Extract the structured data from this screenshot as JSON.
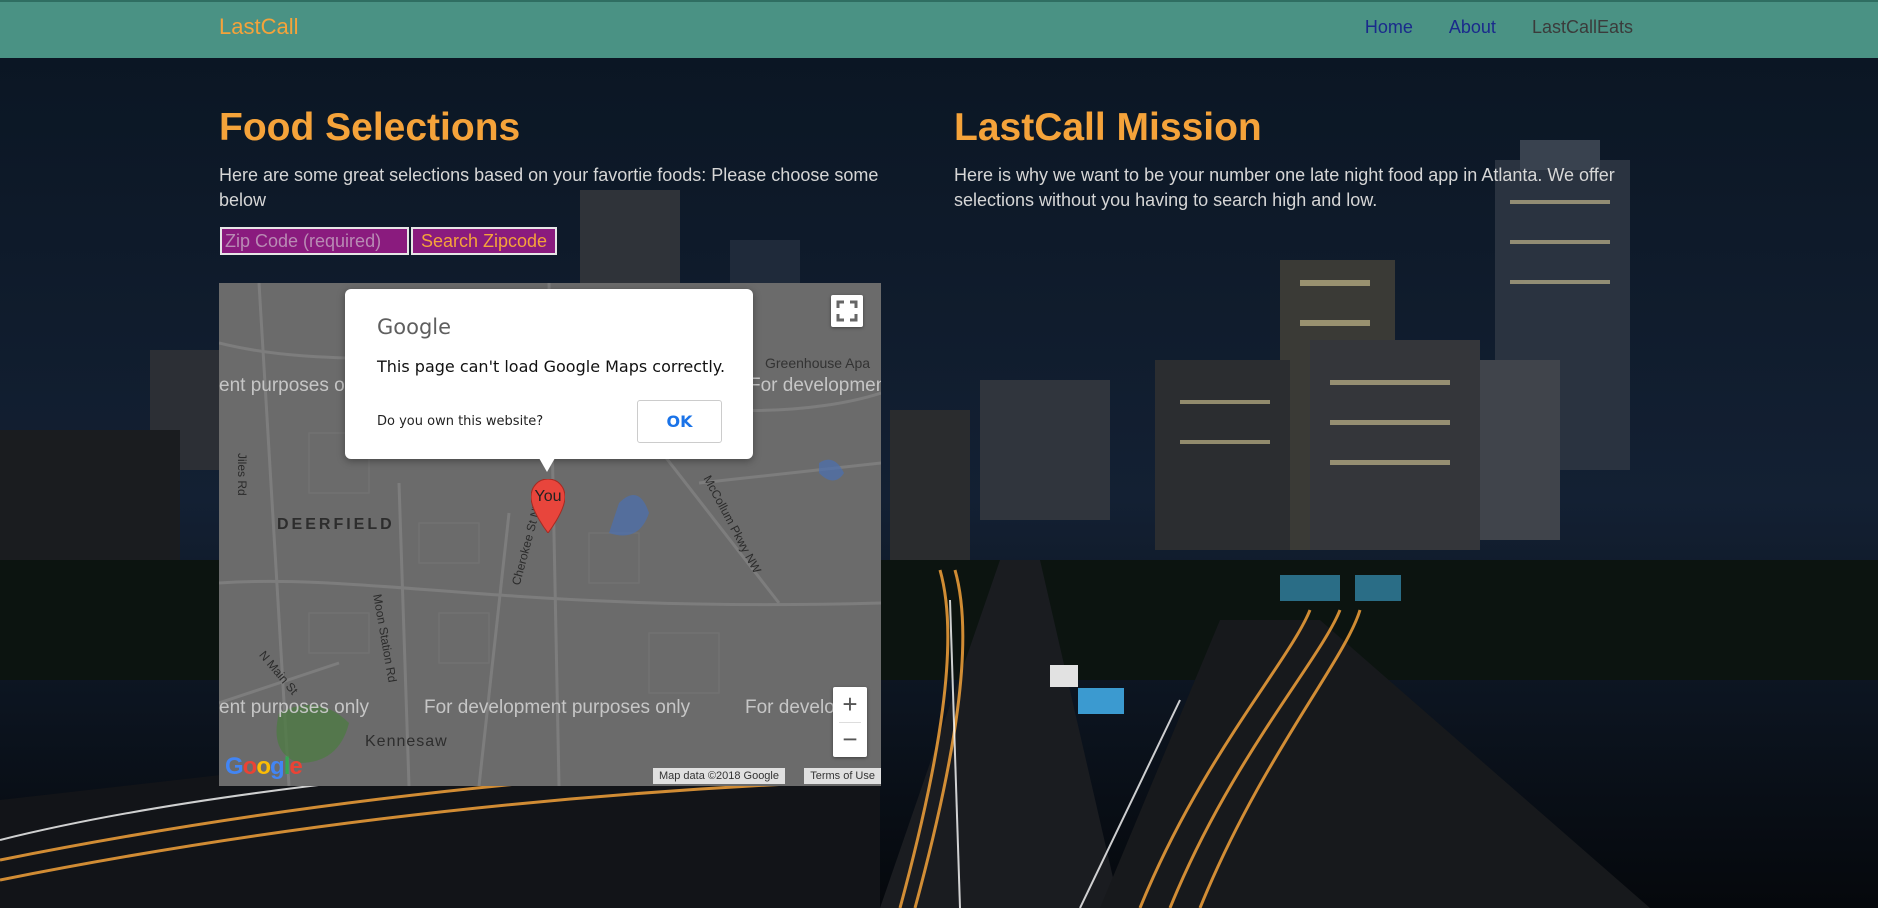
{
  "navbar": {
    "brand": "LastCall",
    "links": [
      "Home",
      "About",
      "LastCallEats"
    ]
  },
  "food": {
    "title": "Food Selections",
    "description": "Here are some great selections based on your favortie foods: Please choose some below",
    "zip_placeholder": "Zip Code (required)",
    "search_label": "Search Zipcode"
  },
  "mission": {
    "title": "LastCall Mission",
    "description": "Here is why we want to be your number one late night food app in Atlanta. We offer selections without you having to search high and low."
  },
  "map": {
    "dev_text_a": "ent purposes only",
    "dev_text_b": "For developmen",
    "dev_text_c": "For development purposes only",
    "dev_text_d": "For develo",
    "labels": {
      "deerfield": "DEERFIELD",
      "kennesaw": "Kennesaw",
      "greenhouse": "Greenhouse Apa",
      "jiles": "Jiles Rd",
      "moon": "Moon Station Rd",
      "cherokee": "Cherokee St NW",
      "mccollum": "McCollum Pkwy NW",
      "nmain": "N Main St"
    },
    "marker_label": "You",
    "google_logo": "Google",
    "attribution": "Map data ©2018 Google",
    "terms": "Terms of Use",
    "zoom_in": "+",
    "zoom_out": "−"
  },
  "dialog": {
    "logo": "Google",
    "message": "This page can't load Google Maps correctly.",
    "question": "Do you own this website?",
    "ok": "OK"
  },
  "colors": {
    "navbar": "#4a9284",
    "accent": "#f5a33a",
    "input_bg": "#8a1b7e"
  }
}
